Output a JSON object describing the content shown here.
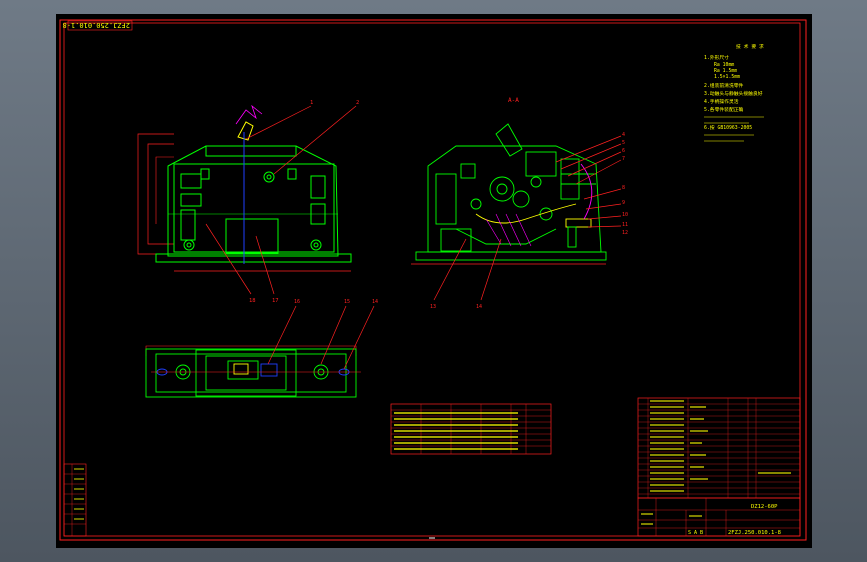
{
  "drawing": {
    "title_number": "2FZJ.250.010.1-8",
    "title_number_mirrored": "2FZJ.250.010.1-8",
    "name": "DZ12-60P",
    "sheet_code": "S A B"
  },
  "view_labels": {
    "section": "A-A"
  },
  "notes": {
    "heading": "技 术 要 求",
    "lines": [
      "1.外形尺寸",
      "Ra 10mm",
      "Ra 1.5mm",
      "1.5×1.5mm",
      "2.组装前清洗零件",
      "3.动触头与静触头接触良好",
      "4.手柄操作灵活",
      "5.各零件装配正确",
      "6.按 GB10963-2005"
    ]
  },
  "balloons": {
    "front": [
      "1",
      "2",
      "18",
      "17"
    ],
    "section": [
      "4",
      "5",
      "6",
      "7",
      "8",
      "9",
      "10",
      "11",
      "12",
      "13",
      "14"
    ],
    "bottom": [
      "16",
      "15",
      "14"
    ]
  },
  "colors": {
    "outline": "#00ff00",
    "frame": "#ff2020",
    "leader": "#ff2020",
    "text": "#ffff00",
    "center": "#2040ff",
    "part": "#ff00ff"
  }
}
